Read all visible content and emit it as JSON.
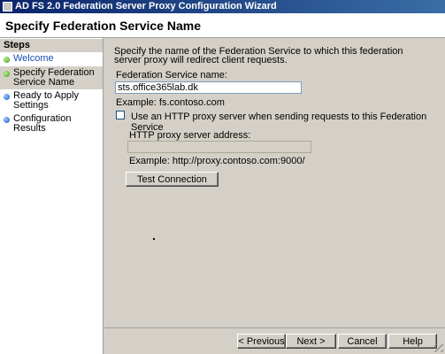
{
  "window": {
    "title": "AD FS 2.0 Federation Server Proxy Configuration Wizard"
  },
  "header": {
    "title": "Specify Federation Service Name"
  },
  "sidebar": {
    "title": "Steps",
    "items": [
      {
        "label": "Welcome",
        "status": "completed"
      },
      {
        "label": "Specify Federation Service Name",
        "status": "current"
      },
      {
        "label": "Ready to Apply Settings",
        "status": "pending"
      },
      {
        "label": "Configuration Results",
        "status": "pending"
      }
    ]
  },
  "main": {
    "intro": "Specify the name of the Federation Service to which this federation server proxy will redirect  client requests.",
    "fs_name_label": "Federation Service name:",
    "fs_name_value": "sts.office365lab.dk",
    "fs_example": "Example: fs.contoso.com",
    "proxy_checkbox_label": "Use an HTTP proxy server when sending requests to this Federation Service",
    "proxy_checked": false,
    "proxy_address_label": "HTTP proxy server address:",
    "proxy_address_value": "",
    "proxy_example": "Example: http://proxy.contoso.com:9000/",
    "test_button": "Test Connection"
  },
  "footer": {
    "previous": "< Previous",
    "next": "Next >",
    "cancel": "Cancel",
    "help": "Help"
  },
  "colors": {
    "titlebar_start": "#0a246a",
    "titlebar_end": "#3a6ea5",
    "link": "#1a4fb0",
    "completed_dot": "#3a9a1a",
    "pending_dot": "#1856c8"
  }
}
